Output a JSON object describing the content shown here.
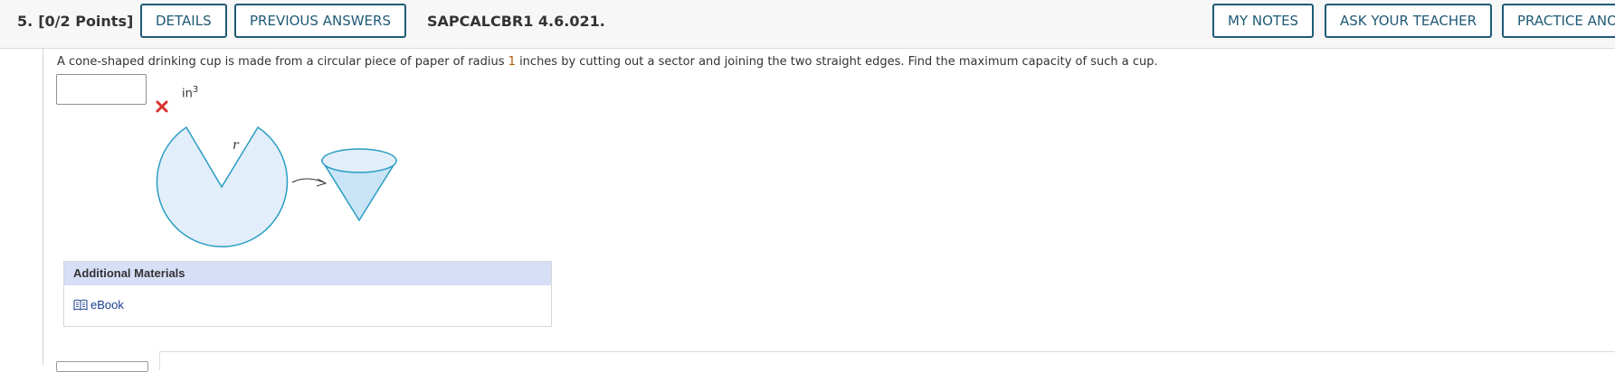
{
  "header": {
    "question_number": "5.",
    "points": "[0/2 Points]",
    "details_label": "DETAILS",
    "previous_answers_label": "PREVIOUS ANSWERS",
    "assignment_id": "SAPCALCBR1 4.6.021.",
    "my_notes_label": "MY NOTES",
    "ask_teacher_label": "ASK YOUR TEACHER",
    "practice_label": "PRACTICE ANOTHER"
  },
  "question": {
    "text_before": "A cone-shaped drinking cup is made from a circular piece of paper of radius ",
    "radius_value": "1",
    "text_after": " inches by cutting out a sector and joining the two straight edges. Find the maximum capacity of such a cup."
  },
  "answer": {
    "value": "",
    "unit_base": "in",
    "unit_exponent": "3",
    "status": "incorrect",
    "status_icon": "x-icon"
  },
  "figure": {
    "radius_label": "r"
  },
  "additional_materials": {
    "title": "Additional Materials",
    "ebook_label": "eBook",
    "ebook_icon": "book-icon"
  },
  "colors": {
    "button_border": "#1f5a76",
    "header_bg": "#f7f7f7",
    "figure_fill": "#e2eef9",
    "figure_stroke": "#2a9dc4",
    "materials_header_bg": "#d7dff7",
    "incorrect": "#d9312d",
    "highlight_value": "#b05800"
  }
}
